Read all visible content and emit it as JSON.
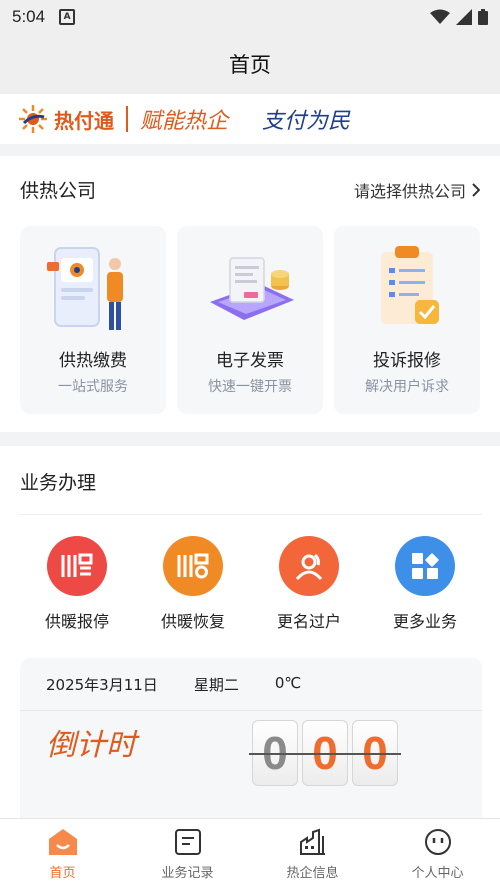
{
  "status_bar": {
    "time": "5:04",
    "notif_letter": "A"
  },
  "header": {
    "title": "首页"
  },
  "banner": {
    "logo": "热付通",
    "slogan1": "赋能热企",
    "slogan2": "支付为民"
  },
  "company": {
    "title": "供热公司",
    "select_label": "请选择供热公司",
    "services": [
      {
        "name": "供热缴费",
        "desc": "一站式服务"
      },
      {
        "name": "电子发票",
        "desc": "快速一键开票"
      },
      {
        "name": "投诉报修",
        "desc": "解决用户诉求"
      }
    ]
  },
  "business": {
    "title": "业务办理",
    "items": [
      {
        "label": "供暖报停",
        "color": "#ee4a45"
      },
      {
        "label": "供暖恢复",
        "color": "#f08a24"
      },
      {
        "label": "更名过户",
        "color": "#f2663a"
      },
      {
        "label": "更多业务",
        "color": "#3d8fe8"
      }
    ]
  },
  "date_info": {
    "date": "2025年3月11日",
    "weekday": "星期二",
    "temperature": "0℃"
  },
  "countdown": {
    "title": "倒计时",
    "digits": [
      "0",
      "0",
      "0"
    ]
  },
  "tabs": [
    {
      "label": "首页",
      "active": true
    },
    {
      "label": "业务记录",
      "active": false
    },
    {
      "label": "热企信息",
      "active": false
    },
    {
      "label": "个人中心",
      "active": false
    }
  ],
  "colors": {
    "accent": "#ef6c2f",
    "brand_orange": "#e05a1c",
    "brand_blue": "#1f3f8a"
  }
}
